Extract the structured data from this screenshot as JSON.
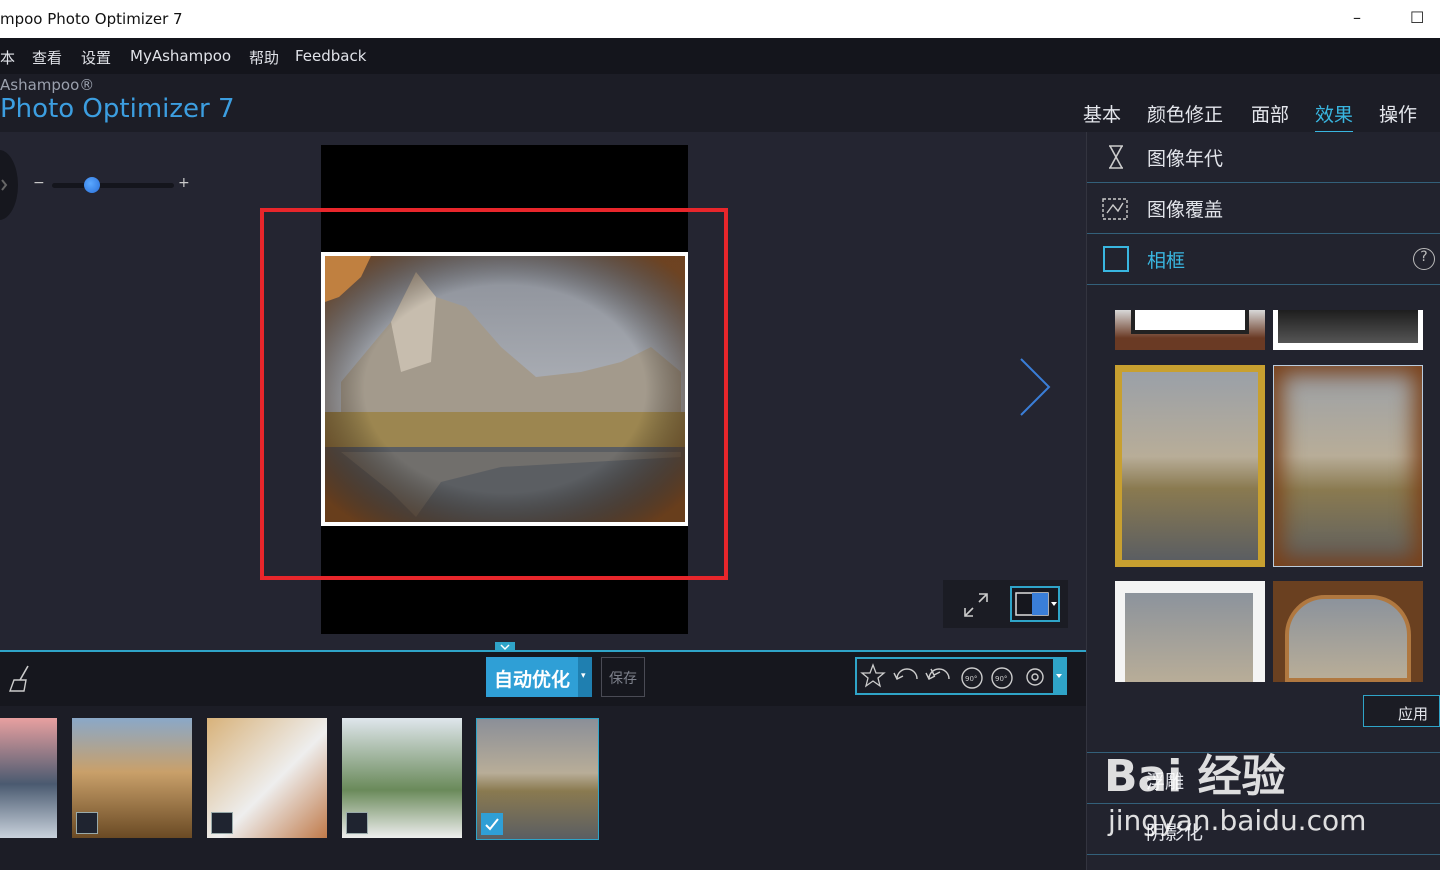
{
  "window": {
    "title": "mpoo Photo Optimizer 7",
    "minimize": "–",
    "maximize": "☐"
  },
  "menu": [
    "本",
    "查看",
    "设置",
    "MyAshampoo",
    "帮助",
    "Feedback"
  ],
  "brand": {
    "company": "Ashampoo®",
    "product": "Photo Optimizer 7"
  },
  "tabs": [
    {
      "label": "基本",
      "active": false
    },
    {
      "label": "颜色修正",
      "active": false
    },
    {
      "label": "面部",
      "active": false
    },
    {
      "label": "效果",
      "active": true
    },
    {
      "label": "操作",
      "active": false
    }
  ],
  "zoom": {
    "minus": "−",
    "plus": "+",
    "level_fraction": 0.33
  },
  "panel": {
    "items": [
      {
        "label": "图像年代",
        "icon": "hourglass-icon"
      },
      {
        "label": "图像覆盖",
        "icon": "overlay-icon"
      },
      {
        "label": "相框",
        "icon": "frame-icon",
        "active": true
      }
    ],
    "help": "?",
    "apply_label": "应用",
    "lower_items": [
      "浮雕",
      "阴影化"
    ]
  },
  "toolbar": {
    "auto_optimize": "自动优化",
    "save": "保存"
  },
  "watermark": {
    "line1": "Bai 经验",
    "line2": "jingyan.baidu.com"
  },
  "colors": {
    "accent": "#2fa4c8",
    "highlight": "#e8262b",
    "brand_blue": "#3c9ee0"
  }
}
